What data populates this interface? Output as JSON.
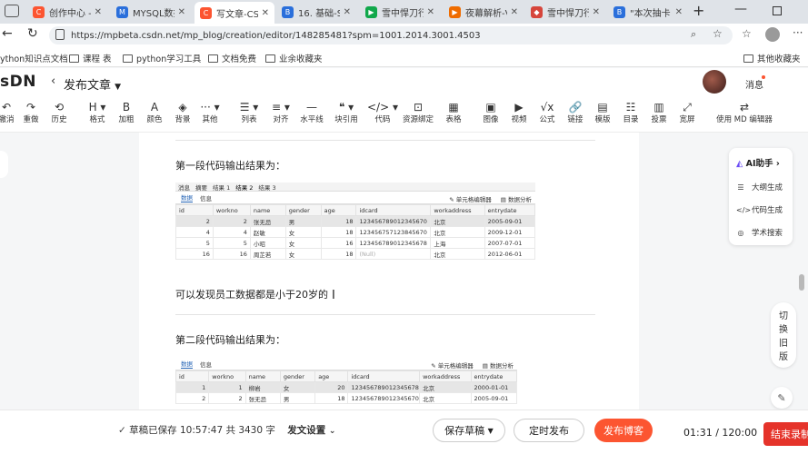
{
  "browser": {
    "tabs": [
      {
        "title": "创作中心 - ",
        "fav": "C",
        "color": "#fc5531"
      },
      {
        "title": "MYSQL数据",
        "fav": "M",
        "color": "#2a6fdb"
      },
      {
        "title": "写文章-CSD",
        "fav": "C",
        "color": "#fc5531",
        "active": true
      },
      {
        "title": "16. 基础-SQ",
        "fav": "B",
        "color": "#2a6fdb"
      },
      {
        "title": "雪中悍刀行",
        "fav": "▶",
        "color": "#11a84b"
      },
      {
        "title": "夜幕解析-V",
        "fav": "▶",
        "color": "#ef6c00"
      },
      {
        "title": "雪中悍刀行",
        "fav": "◆",
        "color": "#d6453b"
      },
      {
        "title": "\"本次抽卡",
        "fav": "B",
        "color": "#2a6fdb"
      }
    ],
    "url": "https://mpbeta.csdn.net/mp_blog/creation/editor/148285481?spm=1001.2014.3001.4503",
    "bookmarks": [
      "ython知识点文档",
      "课程 表",
      "python学习工具",
      "文档免费",
      "业余收藏夹"
    ],
    "bookmarks_right": "其他收藏夹"
  },
  "header": {
    "logo": "sDN",
    "back_label": "发布文章",
    "messages": "消息"
  },
  "toolbar": [
    {
      "icon": "↶",
      "label": "撤消",
      "name": "undo"
    },
    {
      "icon": "↷",
      "label": "重做",
      "name": "redo"
    },
    {
      "icon": "⟲",
      "label": "历史",
      "name": "history"
    },
    {
      "icon": "H ▾",
      "label": "格式",
      "name": "format"
    },
    {
      "icon": "B",
      "label": "加粗",
      "name": "bold"
    },
    {
      "icon": "A",
      "label": "颜色",
      "name": "color"
    },
    {
      "icon": "◈",
      "label": "背景",
      "name": "background"
    },
    {
      "icon": "··· ▾",
      "label": "其他",
      "name": "other"
    },
    {
      "icon": "☰ ▾",
      "label": "列表",
      "name": "list"
    },
    {
      "icon": "≡ ▾",
      "label": "对齐",
      "name": "align"
    },
    {
      "icon": "—",
      "label": "水平线",
      "name": "hr"
    },
    {
      "icon": "❝ ▾",
      "label": "块引用",
      "name": "quote"
    },
    {
      "icon": "</> ▾",
      "label": "代码",
      "name": "code"
    },
    {
      "icon": "⊡",
      "label": "资源绑定",
      "name": "resource"
    },
    {
      "icon": "▦",
      "label": "表格",
      "name": "table"
    },
    {
      "icon": "▣",
      "label": "图像",
      "name": "image"
    },
    {
      "icon": "▶",
      "label": "视频",
      "name": "video"
    },
    {
      "icon": "√x",
      "label": "公式",
      "name": "formula"
    },
    {
      "icon": "🔗",
      "label": "链接",
      "name": "link"
    },
    {
      "icon": "▤",
      "label": "模版",
      "name": "template"
    },
    {
      "icon": "☷",
      "label": "目录",
      "name": "toc"
    },
    {
      "icon": "▥",
      "label": "投票",
      "name": "vote"
    },
    {
      "icon": "⤢",
      "label": "宽屏",
      "name": "widescreen"
    },
    {
      "icon": "⇄",
      "label": "使用 MD 编辑器",
      "name": "md-editor"
    }
  ],
  "editor": {
    "para1": "第一段代码输出结果为：",
    "para2": "可以发现员工数据都是小于20岁的",
    "para3": "第二段代码输出结果为：",
    "result1": {
      "tabs": [
        "消息",
        "摘要",
        "结果 1",
        "结果 2",
        "结果 3"
      ],
      "subtabs": [
        "数据",
        "信息"
      ],
      "tools": [
        "单元格编辑器",
        "数据分析"
      ],
      "columns": [
        "id",
        "workno",
        "name",
        "gender",
        "age",
        "idcard",
        "workaddress",
        "entrydate"
      ],
      "rows": [
        [
          "2",
          "2",
          "张无忌",
          "男",
          "18",
          "123456789012345670",
          "北京",
          "2005-09-01"
        ],
        [
          "4",
          "4",
          "赵敏",
          "女",
          "18",
          "123456757123845670",
          "北京",
          "2009-12-01"
        ],
        [
          "5",
          "5",
          "小昭",
          "女",
          "16",
          "123456789012345678",
          "上海",
          "2007-07-01"
        ],
        [
          "16",
          "16",
          "周芷若",
          "女",
          "18",
          "(Null)",
          "北京",
          "2012-06-01"
        ]
      ]
    },
    "result2": {
      "subtabs": [
        "数据",
        "信息"
      ],
      "tools": [
        "单元格编辑器",
        "数据分析"
      ],
      "columns": [
        "id",
        "workno",
        "name",
        "gender",
        "age",
        "idcard",
        "workaddress",
        "entrydate"
      ],
      "rows": [
        [
          "1",
          "1",
          "柳岩",
          "女",
          "20",
          "123456789012345678",
          "北京",
          "2000-01-01"
        ],
        [
          "2",
          "2",
          "张无忌",
          "男",
          "18",
          "123456789012345670",
          "北京",
          "2005-09-01"
        ]
      ]
    }
  },
  "ai_panel": {
    "title": "AI助手",
    "items": [
      "大纲生成",
      "代码生成",
      "学术搜索"
    ]
  },
  "side": {
    "switch_label": [
      "切",
      "换",
      "旧",
      "版"
    ]
  },
  "bottom": {
    "status": "草稿已保存 10:57:47  共 3430 字",
    "settings": "发文设置",
    "save_draft": "保存草稿",
    "schedule": "定时发布",
    "publish": "发布博客",
    "timer": "01:31 / 120:00",
    "end_record": "结束录制"
  }
}
